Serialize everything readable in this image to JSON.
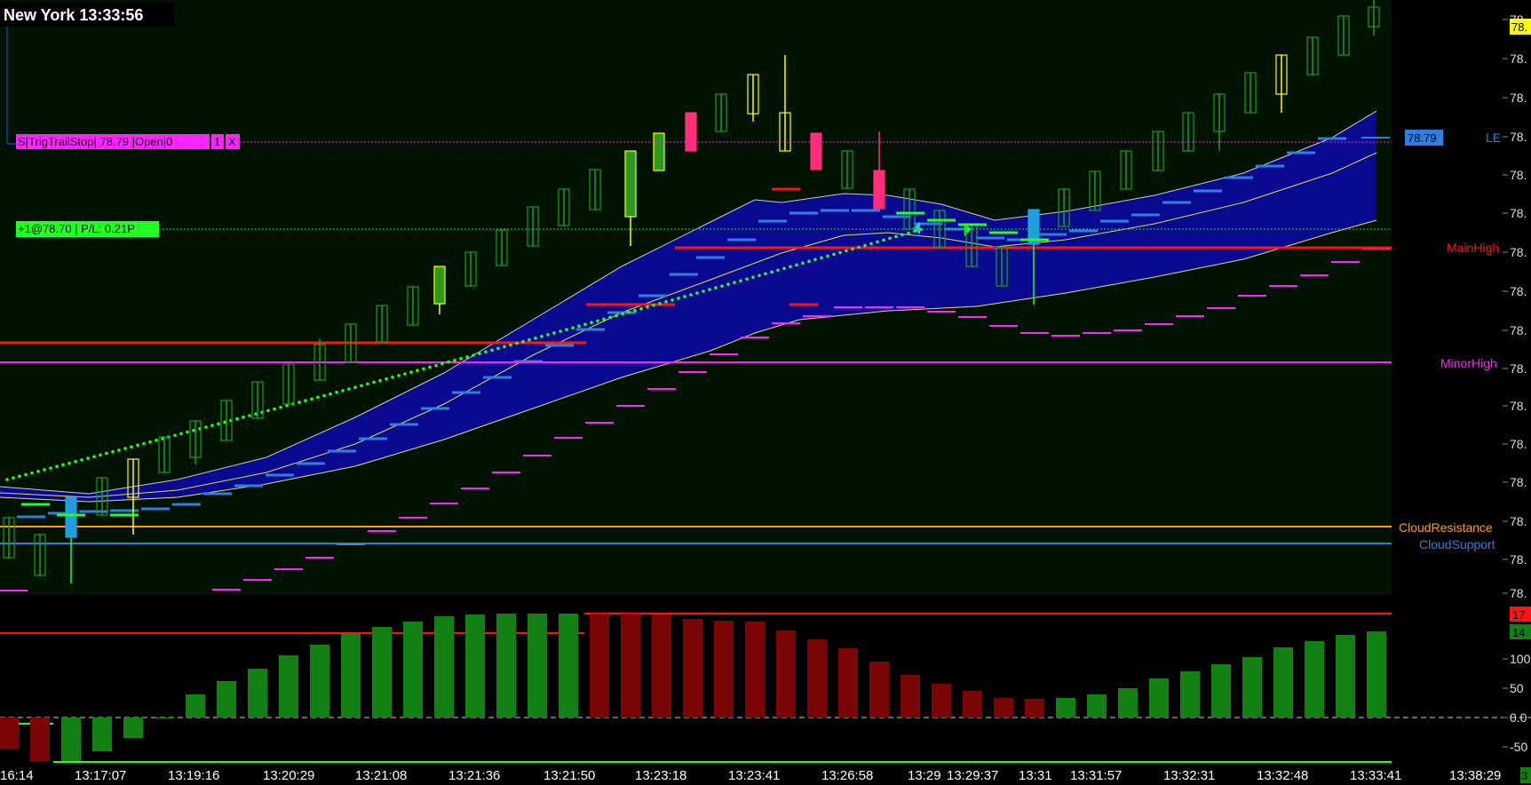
{
  "header": {
    "location": "New York",
    "time": "13:33:56"
  },
  "colors": {
    "main_bg": "#001200",
    "lower_bg": "#000000",
    "cloud_fill": "#0a0a90",
    "bull_candle": "#1a8f1a",
    "bear_candle": "#ff2d7a",
    "up_hist": "#138013",
    "down_hist": "#7a0606",
    "magenta": "#ff24ff",
    "red": "#ff1414",
    "orange": "#ff9a1f",
    "blue": "#2f7fe0",
    "lime": "#22ff22",
    "yellow": "#ffff00"
  },
  "order_tags": {
    "stop": {
      "text": "S|TrigTrailStop| 78.79 |Open|0",
      "qty": "1",
      "close": "X"
    },
    "position": {
      "text": "+1@78.70 | P/L: 0.21P"
    }
  },
  "right_labels": {
    "le": "LE",
    "le_price": "78.79",
    "main_high": "MainHigh",
    "minor_high": "MinorHigh",
    "cloud_resistance": "CloudResistance",
    "cloud_support": "CloudSupport",
    "last_price_tag": "78.",
    "price_ticks": [
      "78.",
      "78.",
      "78.",
      "78.",
      "78.",
      "78.",
      "78.",
      "78.",
      "78.",
      "78.",
      "78.",
      "78.",
      "78.",
      "78.",
      "78.",
      "78."
    ]
  },
  "lower_axis": {
    "ticks": [
      "100",
      "50",
      "0.0",
      "-50"
    ],
    "tag_red": "17",
    "tag_green": "14"
  },
  "time_axis": [
    "16:14",
    "13:17:07",
    "13:19:16",
    "13:20:29",
    "13:21:08",
    "13:21:36",
    "13:21:50",
    "13:23:18",
    "13:23:41",
    "13:26:58",
    "13:29",
    "13:29:37",
    "13:31",
    "13:31:57",
    "13:32:31",
    "13:32:48",
    "13:33:41",
    "13:38:29"
  ],
  "time_axis_last_tag": "3",
  "chart_data": {
    "type": "candlestick",
    "y_range": [
      0,
      15
    ],
    "candles": [
      {
        "o": 1.4,
        "c": 2.2,
        "h": 2.3,
        "l": 1.4,
        "col": "bull"
      },
      {
        "o": 1.0,
        "c": 2.0,
        "h": 2.0,
        "l": 1.0,
        "col": "bull"
      },
      {
        "o": 2.4,
        "c": 3.6,
        "h": 3.6,
        "l": 1.0,
        "col": "cyan"
      },
      {
        "o": 3.2,
        "c": 4.2,
        "h": 4.2,
        "l": 3.2,
        "col": "bull"
      },
      {
        "o": 3.0,
        "c": 4.4,
        "h": 4.4,
        "l": 2.2,
        "col": "yellow"
      },
      {
        "o": 4.4,
        "c": 5.4,
        "h": 5.4,
        "l": 4.4,
        "col": "bull"
      },
      {
        "o": 5.2,
        "c": 6.2,
        "h": 6.2,
        "l": 4.8,
        "col": "bull"
      },
      {
        "o": 6.0,
        "c": 7.0,
        "h": 7.0,
        "l": 6.0,
        "col": "bull"
      },
      {
        "o": 6.8,
        "c": 7.8,
        "h": 7.8,
        "l": 6.8,
        "col": "bull"
      },
      {
        "o": 7.4,
        "c": 8.6,
        "h": 8.6,
        "l": 7.4,
        "col": "bull"
      },
      {
        "o": 8.4,
        "c": 9.4,
        "h": 9.5,
        "l": 8.4,
        "col": "bull"
      },
      {
        "o": 8.8,
        "c": 10.0,
        "h": 10.0,
        "l": 8.8,
        "col": "bull"
      },
      {
        "o": 9.4,
        "c": 10.4,
        "h": 10.4,
        "l": 9.4,
        "col": "bull"
      },
      {
        "o": 10.0,
        "c": 11.0,
        "h": 11.0,
        "l": 10.0,
        "col": "bull"
      },
      {
        "o": 10.8,
        "c": 11.8,
        "h": 11.8,
        "l": 10.6,
        "col": "greenfill"
      },
      {
        "o": 11.4,
        "c": 12.6,
        "h": 12.6,
        "l": 11.4,
        "col": "bull"
      },
      {
        "o": 12.0,
        "c": 13.2,
        "h": 13.2,
        "l": 12.0,
        "col": "bull"
      },
      {
        "o": 12.8,
        "c": 13.8,
        "h": 13.8,
        "l": 12.8,
        "col": "bull"
      },
      {
        "o": 13.6,
        "c": 14.6,
        "h": 14.6,
        "l": 13.6,
        "col": "bull"
      },
      {
        "o": 14.0,
        "c": 15.0,
        "h": 15.0,
        "l": 14.0,
        "col": "bull"
      },
      {
        "o": 15.0,
        "c": 15.8,
        "h": 15.8,
        "l": 15.0,
        "col": "bull"
      },
      {
        "o": 15.4,
        "c": 16.4,
        "h": 16.4,
        "l": 15.4,
        "col": "bull"
      },
      {
        "o": 16.0,
        "c": 17.0,
        "h": 17.0,
        "l": 16.0,
        "col": "bull"
      },
      {
        "o": 16.8,
        "c": 17.8,
        "h": 17.8,
        "l": 16.8,
        "col": "bull"
      },
      {
        "o": 17.6,
        "c": 18.6,
        "h": 18.6,
        "l": 17.6,
        "col": "bull"
      },
      {
        "o": 18.4,
        "c": 19.4,
        "h": 19.4,
        "l": 17.8,
        "col": "greenfill"
      },
      {
        "o": 19.6,
        "c": 19.6,
        "h": 19.6,
        "l": 19.6,
        "col": "none"
      },
      {
        "o": 19.0,
        "c": 20.0,
        "h": 20.0,
        "l": 19.0,
        "col": "bull"
      },
      {
        "o": 19.6,
        "c": 20.6,
        "h": 20.6,
        "l": 19.6,
        "col": "bull"
      },
      {
        "o": 20.2,
        "c": 21.2,
        "h": 21.2,
        "l": 20.2,
        "col": "bull"
      }
    ]
  }
}
